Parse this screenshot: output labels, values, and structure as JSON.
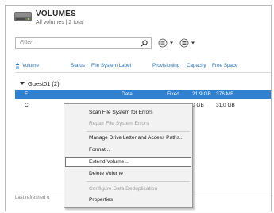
{
  "header": {
    "title": "VOLUMES",
    "subtitle": "All volumes | 2 total"
  },
  "filter": {
    "placeholder": "Filter"
  },
  "toolbar": {
    "icons": [
      "search-icon",
      "list-view-icon",
      "group-by-icon"
    ]
  },
  "table": {
    "columns": [
      "Volume",
      "Status",
      "File System Label",
      "Provisioning",
      "Capacity",
      "Free Space"
    ],
    "group": "Guest01 (2)",
    "rows": [
      {
        "volume": "E:",
        "status": "",
        "label": "Data",
        "provisioning": "Fixed",
        "capacity": "21.9 GB",
        "free": "376 MB",
        "selected": true
      },
      {
        "volume": "C:",
        "status": "",
        "label": "",
        "provisioning": "",
        "capacity": "0 GB",
        "free": "31.0 GB",
        "selected": false
      }
    ]
  },
  "footer": {
    "last_refreshed": "Last refreshed o"
  },
  "context_menu": {
    "items": [
      {
        "label": "Scan File System for Errors",
        "enabled": true
      },
      {
        "label": "Repair File System Errors",
        "enabled": false
      },
      {
        "label": "Manage Drive Letter and Access Paths...",
        "enabled": true
      },
      {
        "label": "Format...",
        "enabled": true
      },
      {
        "label": "Extend Volume...",
        "enabled": true,
        "highlighted": true
      },
      {
        "label": "Delete Volume",
        "enabled": true
      },
      {
        "label": "Configure Data Deduplication",
        "enabled": false
      },
      {
        "label": "Properties",
        "enabled": true
      }
    ]
  },
  "colors": {
    "selection": "#2f80d1",
    "column_header": "#2a6fb0"
  }
}
